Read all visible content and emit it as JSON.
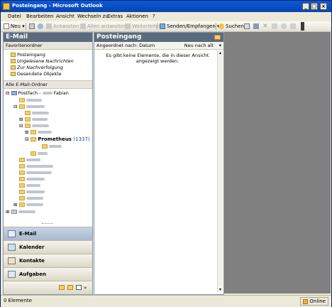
{
  "window": {
    "title": "Posteingang - Microsoft Outlook",
    "min_label": "_",
    "max_label": "□",
    "close_label": "×"
  },
  "menu": [
    "Datei",
    "Bearbeiten",
    "Ansicht",
    "Wechseln zu",
    "Extras",
    "Aktionen",
    "?"
  ],
  "toolbar": {
    "new_label": "Neu",
    "reply_label": "Antworten",
    "reply_all_label": "Allen antworten",
    "forward_label": "Weiterleiten",
    "send_receive_label": "Senden/Empfangen",
    "search_label": "Suchen"
  },
  "nav": {
    "title": "E-Mail",
    "favorites_header": "Favoritenordner",
    "favorites": [
      "Posteingang",
      "Ungelesene Nachrichten",
      "Zur Nachverfolgung",
      "Gesendete Objekte"
    ],
    "all_header": "Alle E-Mail-Ordner",
    "mailbox_prefix": "Postfach -",
    "mailbox_suffix": "Fabian",
    "open_folder": "Prometheus",
    "open_folder_count": "(1337)",
    "buttons": [
      "E-Mail",
      "Kalender",
      "Kontakte",
      "Aufgaben"
    ]
  },
  "list": {
    "title": "Posteingang",
    "sort_label": "Angeordnet nach: Datum",
    "order_label": "Neu nach alt",
    "empty_message": "Es gibt keine Elemente, die in dieser Ansicht angezeigt werden."
  },
  "status": {
    "items": "0 Elemente",
    "online": "Online"
  }
}
